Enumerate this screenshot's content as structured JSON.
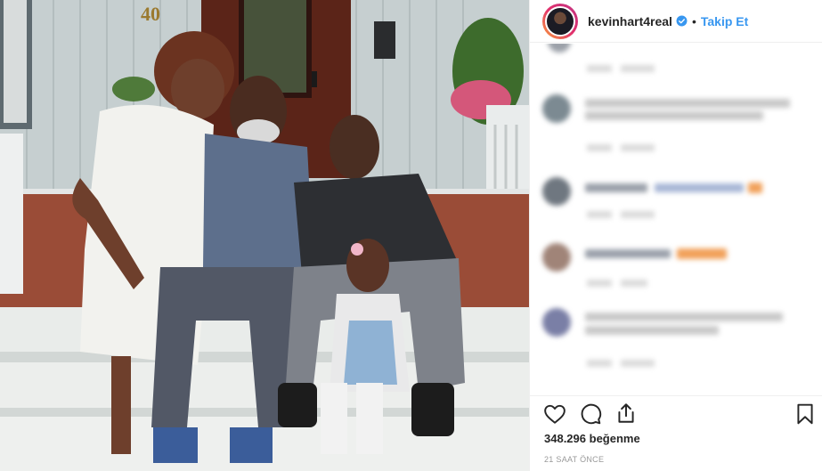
{
  "post": {
    "house_number": "40",
    "photo_alt": "family-photo"
  },
  "header": {
    "username": "kevinhart4real",
    "separator": "•",
    "follow_label": "Takip Et"
  },
  "footer": {
    "likes_count": "348.296",
    "likes_label": "beğenme",
    "time_ago": "21 SAAT ÖNCE"
  },
  "colors": {
    "follow_blue": "#3897f0",
    "text_dark": "#262626",
    "text_muted": "#999999",
    "verified_blue": "#3897f0"
  },
  "icons": {
    "like": "heart-icon",
    "comment": "comment-bubble-icon",
    "share": "share-icon",
    "save": "bookmark-icon",
    "verified": "verified-badge-icon"
  }
}
